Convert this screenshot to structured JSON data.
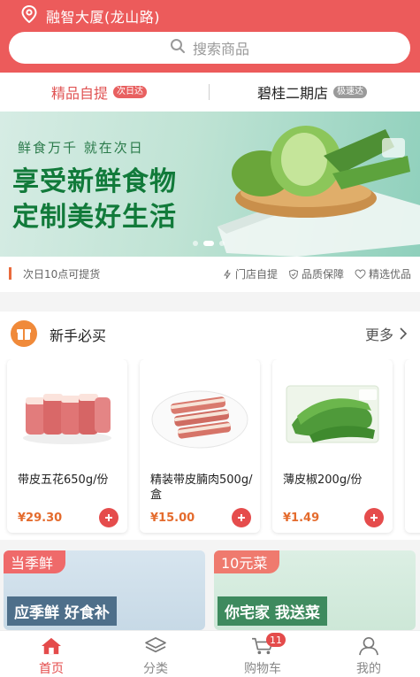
{
  "header": {
    "location": "融智大厦(龙山路)",
    "search_placeholder": "搜索商品"
  },
  "mode_switch": [
    {
      "label": "精品自提",
      "tag": "次日达",
      "active": true
    },
    {
      "label": "碧桂二期店",
      "tag": "极速达",
      "active": false
    }
  ],
  "banner": {
    "subtitle": "鲜食万千 就在次日",
    "title_line1": "享受新鲜食物",
    "title_line2": "定制美好生活"
  },
  "info_strip": {
    "notice": "次日10点可提货",
    "features": [
      "门店自提",
      "品质保障",
      "精选优品"
    ]
  },
  "newbie_section": {
    "title": "新手必买",
    "more_label": "更多",
    "products": [
      {
        "name": "带皮五花650g/份",
        "price": "¥29.30",
        "image": "pork-belly"
      },
      {
        "name": "精装带皮腩肉500g/盒",
        "price": "¥15.00",
        "image": "pork-slices"
      },
      {
        "name": "薄皮椒200g/份",
        "price": "¥1.49",
        "image": "green-pepper"
      }
    ]
  },
  "promos": [
    {
      "tag": "当季鲜",
      "subtitle": "应季鲜 好食补"
    },
    {
      "tag": "10元菜",
      "subtitle": "你宅家 我送菜"
    }
  ],
  "tabbar": {
    "items": [
      {
        "label": "首页",
        "icon": "home-icon",
        "active": true
      },
      {
        "label": "分类",
        "icon": "layers-icon",
        "active": false
      },
      {
        "label": "购物车",
        "icon": "cart-icon",
        "active": false,
        "badge": "11"
      },
      {
        "label": "我的",
        "icon": "user-icon",
        "active": false
      }
    ]
  },
  "colors": {
    "brand_red": "#ec5b5b",
    "price_orange": "#e46b2d",
    "banner_green": "#117a3a"
  }
}
